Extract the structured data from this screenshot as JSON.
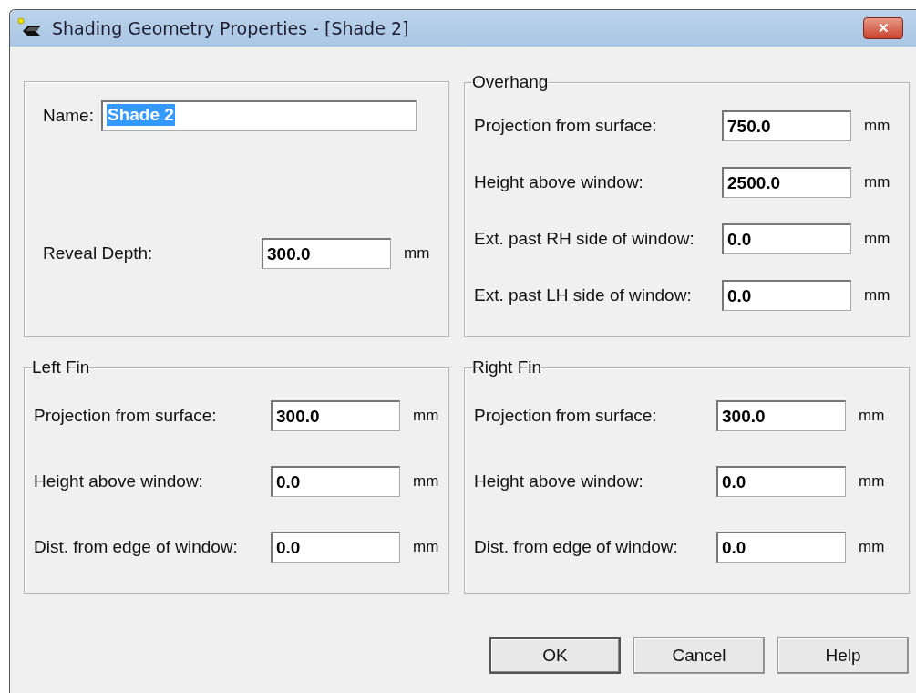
{
  "window": {
    "title": "Shading Geometry Properties - [Shade 2]",
    "close_label": "✕"
  },
  "general": {
    "name": {
      "label": "Name:",
      "value": "Shade 2",
      "text_selected": true
    },
    "reveal_depth": {
      "label": "Reveal Depth:",
      "value": "300.0",
      "unit": "mm"
    }
  },
  "groups": [
    {
      "title": "Overhang",
      "fields": [
        {
          "label": "Projection from surface:",
          "value": "750.0",
          "unit": "mm"
        },
        {
          "label": "Height above window:",
          "value": "2500.0",
          "unit": "mm"
        },
        {
          "label": "Ext. past RH side of window:",
          "value": "0.0",
          "unit": "mm"
        },
        {
          "label": "Ext. past LH side of window:",
          "value": "0.0",
          "unit": "mm"
        }
      ]
    },
    {
      "title": "Left Fin",
      "fields": [
        {
          "label": "Projection from surface:",
          "value": "300.0",
          "unit": "mm"
        },
        {
          "label": "Height above window:",
          "value": "0.0",
          "unit": "mm"
        },
        {
          "label": "Dist. from edge of window:",
          "value": "0.0",
          "unit": "mm"
        }
      ]
    },
    {
      "title": "Right Fin",
      "fields": [
        {
          "label": "Projection from surface:",
          "value": "300.0",
          "unit": "mm"
        },
        {
          "label": "Height above window:",
          "value": "0.0",
          "unit": "mm"
        },
        {
          "label": "Dist. from edge of window:",
          "value": "0.0",
          "unit": "mm"
        }
      ]
    }
  ],
  "buttons": [
    {
      "label": "OK",
      "default": true
    },
    {
      "label": "Cancel",
      "default": false
    },
    {
      "label": "Help",
      "default": false
    }
  ]
}
